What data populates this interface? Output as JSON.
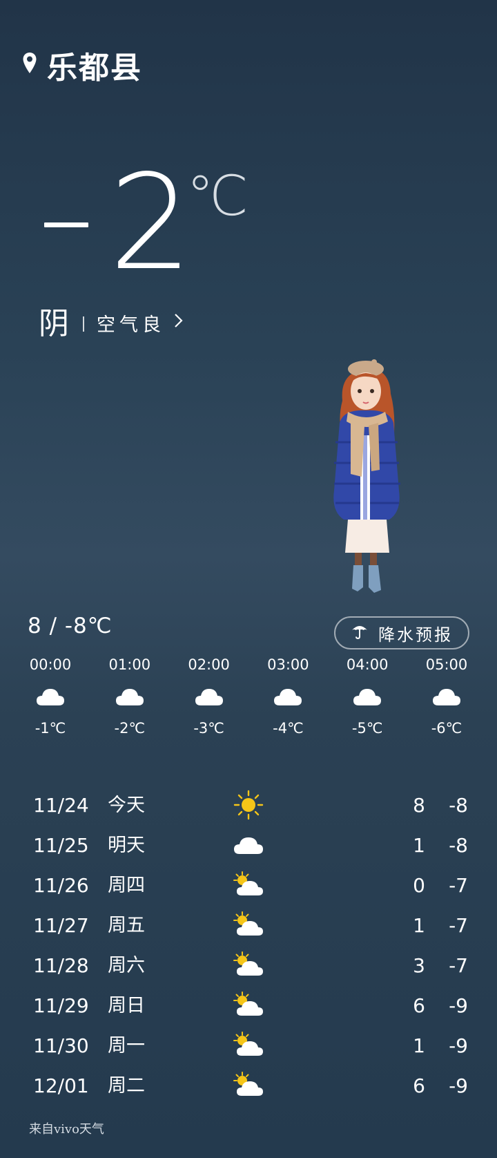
{
  "location": {
    "icon": "location-pin-icon",
    "name": "乐都县"
  },
  "current": {
    "temp": "2",
    "unit": "℃",
    "condition": "阴",
    "air_quality": "空气良"
  },
  "today_range": "8 / -8℃",
  "rain_forecast": {
    "icon": "umbrella-icon",
    "label": "降水预报"
  },
  "hourly": [
    {
      "time": "00:00",
      "icon": "cloud-icon",
      "temp": "-1℃"
    },
    {
      "time": "01:00",
      "icon": "cloud-icon",
      "temp": "-2℃"
    },
    {
      "time": "02:00",
      "icon": "cloud-icon",
      "temp": "-3℃"
    },
    {
      "time": "03:00",
      "icon": "cloud-icon",
      "temp": "-4℃"
    },
    {
      "time": "04:00",
      "icon": "cloud-icon",
      "temp": "-5℃"
    },
    {
      "time": "05:00",
      "icon": "cloud-icon",
      "temp": "-6℃"
    }
  ],
  "daily": [
    {
      "date": "11/24",
      "name": "今天",
      "icon": "sun-icon",
      "hi": "8",
      "lo": "-8"
    },
    {
      "date": "11/25",
      "name": "明天",
      "icon": "cloud-icon",
      "hi": "1",
      "lo": "-8"
    },
    {
      "date": "11/26",
      "name": "周四",
      "icon": "partly-cloudy-icon",
      "hi": "0",
      "lo": "-7"
    },
    {
      "date": "11/27",
      "name": "周五",
      "icon": "partly-cloudy-icon",
      "hi": "1",
      "lo": "-7"
    },
    {
      "date": "11/28",
      "name": "周六",
      "icon": "partly-cloudy-icon",
      "hi": "3",
      "lo": "-7"
    },
    {
      "date": "11/29",
      "name": "周日",
      "icon": "partly-cloudy-icon",
      "hi": "6",
      "lo": "-9"
    },
    {
      "date": "11/30",
      "name": "周一",
      "icon": "partly-cloudy-icon",
      "hi": "1",
      "lo": "-9"
    },
    {
      "date": "12/01",
      "name": "周二",
      "icon": "partly-cloudy-icon",
      "hi": "6",
      "lo": "-9"
    }
  ],
  "source": "来自vivo天气",
  "colors": {
    "sun": "#f5c518",
    "cloud": "#ffffff",
    "background_top": "#213448",
    "background_mid": "#344b60"
  }
}
